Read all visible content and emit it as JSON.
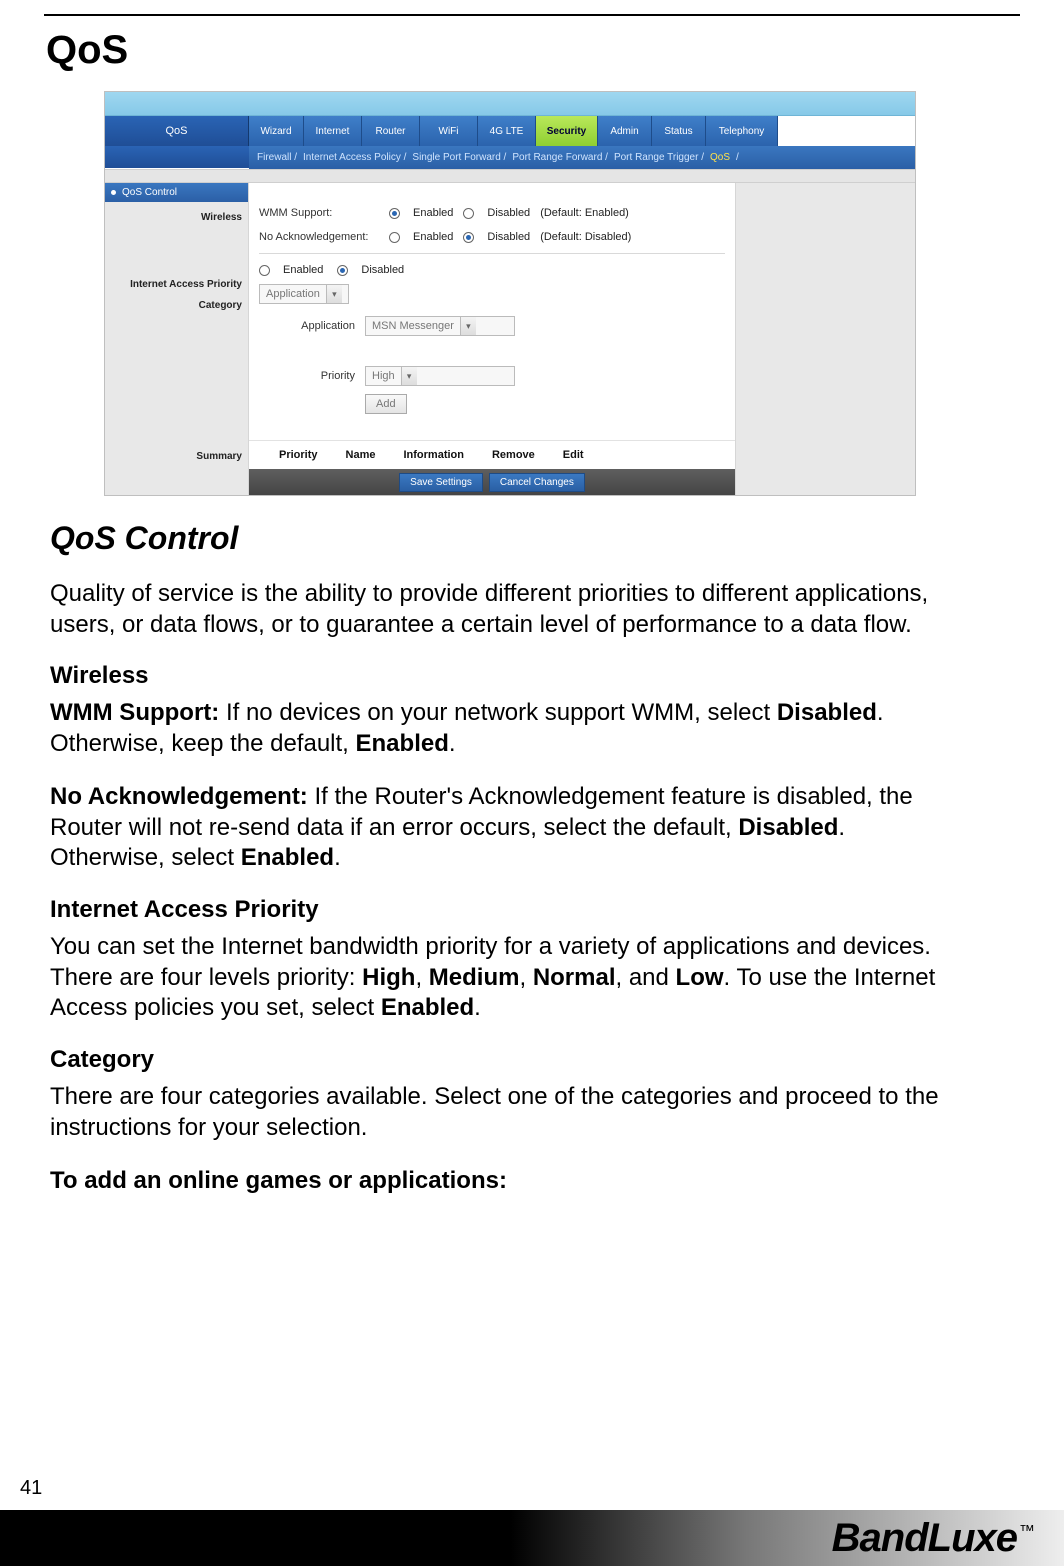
{
  "page": {
    "number": "41",
    "title": "QoS",
    "brand": "BandLuxe",
    "tm": "™"
  },
  "shot": {
    "left_title": "QoS",
    "tabs": [
      "Wizard",
      "Internet",
      "Router",
      "WiFi",
      "4G LTE",
      "Security",
      "Admin",
      "Status",
      "Telephony"
    ],
    "tabs_selected_index": 5,
    "subtabs": [
      "Firewall /",
      "Internet Access Policy /",
      "Single Port Forward /",
      "Port Range Forward /",
      "Port Range Trigger /",
      "QoS",
      "/"
    ],
    "subtabs_selected_index": 5,
    "side": {
      "header": "QoS Control",
      "labels": [
        "Wireless",
        "Internet Access Priority",
        "Category",
        "Summary"
      ]
    },
    "wireless": {
      "wmm_label": "WMM Support:",
      "noack_label": "No Acknowledgement:",
      "opt_enabled": "Enabled",
      "opt_disabled": "Disabled",
      "wmm_default": "(Default: Enabled)",
      "noack_default": "(Default: Disabled)"
    },
    "iap": {
      "opt_enabled": "Enabled",
      "opt_disabled": "Disabled"
    },
    "category": {
      "dropdown": "Application",
      "app_label": "Application",
      "app_value": "MSN Messenger",
      "prio_label": "Priority",
      "prio_value": "High",
      "add_btn": "Add"
    },
    "summary_headers": [
      "Priority",
      "Name",
      "Information",
      "Remove",
      "Edit"
    ],
    "footer_buttons": [
      "Save Settings",
      "Cancel Changes"
    ]
  },
  "doc": {
    "h2": "QoS Control",
    "p1": "Quality of service is the ability to provide different priorities to different applications, users, or data flows, or to guarantee a certain level of performance to a data flow.",
    "h3_wireless": "Wireless",
    "p_wmm_lead": "WMM Support:",
    "p_wmm_rest": " If no devices on your network support WMM, select ",
    "p_wmm_b1": "Disabled",
    "p_wmm_mid": ". Otherwise, keep the default, ",
    "p_wmm_b2": "Enabled",
    "p_wmm_end": ".",
    "p_noack_lead": "No Acknowledgement:",
    "p_noack_rest": " If the Router's Acknowledgement feature is disabled, the Router will not re-send data if an error occurs, select the default, ",
    "p_noack_b1": "Disabled",
    "p_noack_mid": ". Otherwise, select ",
    "p_noack_b2": "Enabled",
    "p_noack_end": ".",
    "h3_iap": "Internet Access Priority",
    "p_iap_a": "You can set the Internet bandwidth priority for a variety of applications and devices. There are four levels priority: ",
    "p_iap_b1": "High",
    "p_iap_c1": ", ",
    "p_iap_b2": "Medium",
    "p_iap_c2": ", ",
    "p_iap_b3": "Normal",
    "p_iap_c3": ", and ",
    "p_iap_b4": "Low",
    "p_iap_d": ". To use the Internet Access policies you set, select ",
    "p_iap_b5": "Enabled",
    "p_iap_e": ".",
    "h3_cat": "Category",
    "p_cat": "There are four categories available. Select one of the categories and proceed to the instructions for your selection.",
    "p_add": "To add an online games or applications:"
  }
}
